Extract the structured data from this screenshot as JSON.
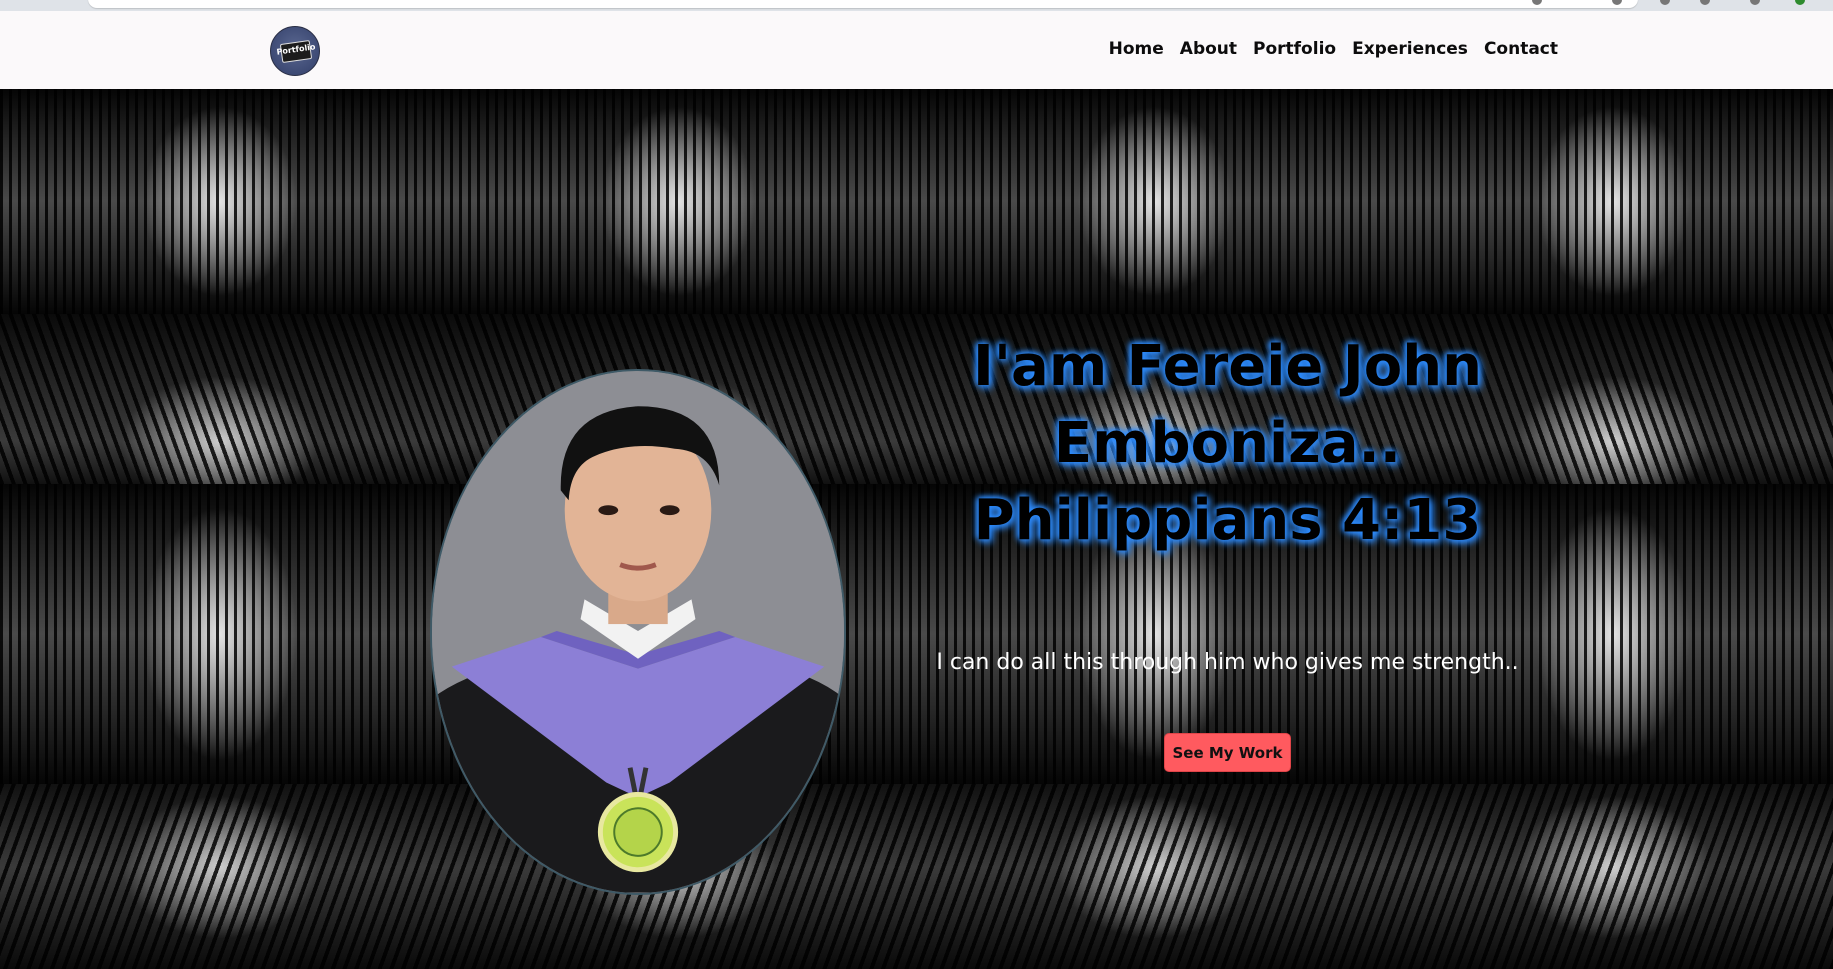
{
  "nav": {
    "logo_text": "Portfolio",
    "links": [
      "Home",
      "About",
      "Portfolio",
      "Experiences",
      "Contact"
    ]
  },
  "hero": {
    "title_line1": "I'am Fereie John",
    "title_line2": "Emboniza..",
    "title_line3": "Philippians 4:13",
    "subtitle": "I can do all this through him who gives me strength..",
    "cta_label": "See My Work"
  },
  "colors": {
    "navbar_bg": "#fbf9fa",
    "title_glow": "#2d8cff",
    "cta_bg": "#ff5a5f"
  },
  "icons": {
    "logo": "portfolio-logo-icon",
    "profile": "profile-photo"
  }
}
